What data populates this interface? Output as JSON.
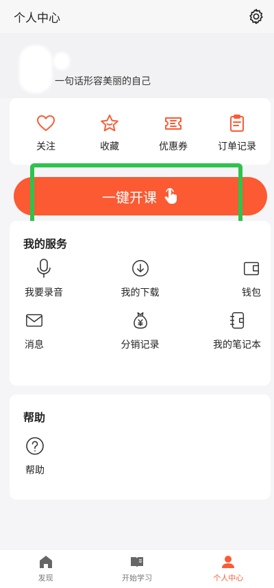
{
  "header": {
    "title": "个人中心",
    "settings_icon": "gear-icon"
  },
  "profile": {
    "signature": "一句话形容美丽的自己"
  },
  "shortcuts": [
    {
      "label": "关注",
      "icon": "heart-icon"
    },
    {
      "label": "收藏",
      "icon": "star-icon"
    },
    {
      "label": "优惠券",
      "icon": "ticket-icon"
    },
    {
      "label": "订单记录",
      "icon": "clipboard-icon"
    }
  ],
  "open_course_button": {
    "label": "一键开课",
    "icon": "hand-pointer-icon"
  },
  "services": {
    "title": "我的服务",
    "items": [
      {
        "label": "我要录音",
        "icon": "microphone-icon"
      },
      {
        "label": "我的下载",
        "icon": "download-icon"
      },
      {
        "label": "钱包",
        "icon": "wallet-icon"
      },
      {
        "label": "消息",
        "icon": "mail-icon"
      },
      {
        "label": "分销记录",
        "icon": "money-bag-icon"
      },
      {
        "label": "我的笔记本",
        "icon": "notebook-icon"
      }
    ]
  },
  "help": {
    "title": "帮助",
    "items": [
      {
        "label": "帮助",
        "icon": "question-icon"
      }
    ]
  },
  "tabbar": {
    "tabs": [
      {
        "label": "发现",
        "icon": "home-icon",
        "active": false
      },
      {
        "label": "开始学习",
        "icon": "book-icon",
        "active": false
      },
      {
        "label": "个人中心",
        "icon": "user-icon",
        "active": true
      }
    ]
  },
  "colors": {
    "accent": "#fb5a33",
    "highlight": "#2fc24d",
    "background": "#f5f5f7"
  }
}
